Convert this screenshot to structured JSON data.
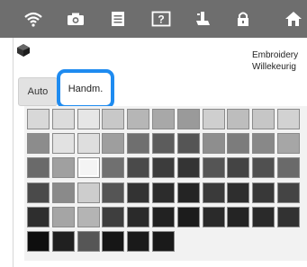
{
  "toolbar": {
    "icons": [
      "wifi-icon",
      "camera-icon",
      "document-icon",
      "help-icon",
      "presser-foot-icon",
      "lock-icon",
      "home-icon"
    ]
  },
  "header": {
    "title_line1": "Embroidery",
    "title_line2": "Willekeurig"
  },
  "tabs": {
    "auto_label": "Auto",
    "handm_label": "Handm."
  },
  "colors": {
    "accent": "#1e8bf0",
    "topbar": "#6e6e6e"
  },
  "palette": {
    "columns": 11,
    "rows": [
      [
        "#d8d8d8",
        "#dcdcdc",
        "#e6e6e6",
        "#c8c8c8",
        "#b6b6b6",
        "#a8a8a8",
        "#9a9a9a",
        "#cfcfcf",
        "#bdbdbd",
        "#c6c6c6",
        "#d2d2d2"
      ],
      [
        "#8c8c8c",
        "#e2e2e2",
        "#dedede",
        "#9e9e9e",
        "#6f6f6f",
        "#5c5c5c",
        "#555555",
        "#8e8e8e",
        "#7c7c7c",
        "#888888",
        "#a6a6a6"
      ],
      [
        "#6a6a6a",
        "#a0a0a0",
        "#f4f4f4",
        "#707070",
        "#4a4a4a",
        "#3c3c3c",
        "#343434",
        "#555555",
        "#444444",
        "#505050",
        "#6a6a6a"
      ],
      [
        "#4a4a4a",
        "#8a8a8a",
        "#cdcdcd",
        "#555555",
        "#333333",
        "#2c2c2c",
        "#242424",
        "#3a3a3a",
        "#2e2e2e",
        "#383838",
        "#444444"
      ],
      [
        "#2e2e2e",
        "#a5a5a5",
        "#b4b4b4",
        "#3e3e3e",
        "#2a2a2a",
        "#222222",
        "#1c1c1c",
        "#2a2a2a",
        "#242424",
        "#2a2a2a",
        "#323232"
      ],
      [
        "#0e0e0e",
        "#202020",
        "#565656",
        "#161616",
        "#1a1a1a",
        "#1a1a1a"
      ]
    ]
  }
}
